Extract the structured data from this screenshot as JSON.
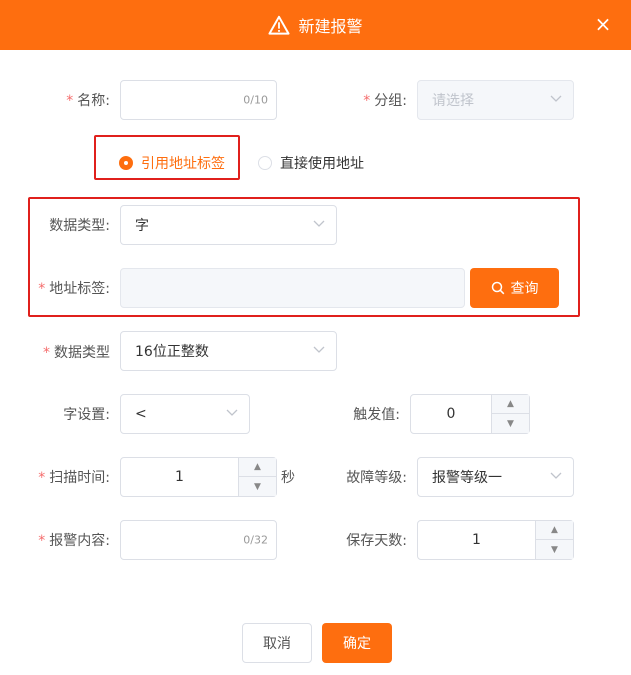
{
  "dialog": {
    "title": "新建报警",
    "close_icon": "×"
  },
  "form": {
    "name": {
      "label": "名称:",
      "required": "*",
      "value": "",
      "counter": "0/10"
    },
    "group": {
      "label": "分组:",
      "required": "*",
      "placeholder": "请选择"
    },
    "address_mode": {
      "options": [
        "引用地址标签",
        "直接使用地址"
      ],
      "selected": 0
    },
    "data_type_ref": {
      "label": "数据类型:",
      "value": "字"
    },
    "address_tag": {
      "label": "地址标签:",
      "required": "*",
      "value": "",
      "search_label": "查询"
    },
    "data_type": {
      "label": "数据类型",
      "required": "*",
      "value": "16位正整数"
    },
    "word_setting": {
      "label": "字设置:",
      "value": "<"
    },
    "trigger_value": {
      "label": "触发值:",
      "value": "0"
    },
    "scan_time": {
      "label": "扫描时间:",
      "required": "*",
      "value": "1",
      "unit": "秒"
    },
    "fault_level": {
      "label": "故障等级:",
      "value": "报警等级一"
    },
    "alarm_content": {
      "label": "报警内容:",
      "required": "*",
      "value": "",
      "counter": "0/32"
    },
    "save_days": {
      "label": "保存天数:",
      "value": "1"
    }
  },
  "footer": {
    "cancel_label": "取消",
    "confirm_label": "确定"
  },
  "colors": {
    "accent": "#fe6e0f",
    "highlight_border": "#e0201c",
    "required": "#f56c6c"
  }
}
